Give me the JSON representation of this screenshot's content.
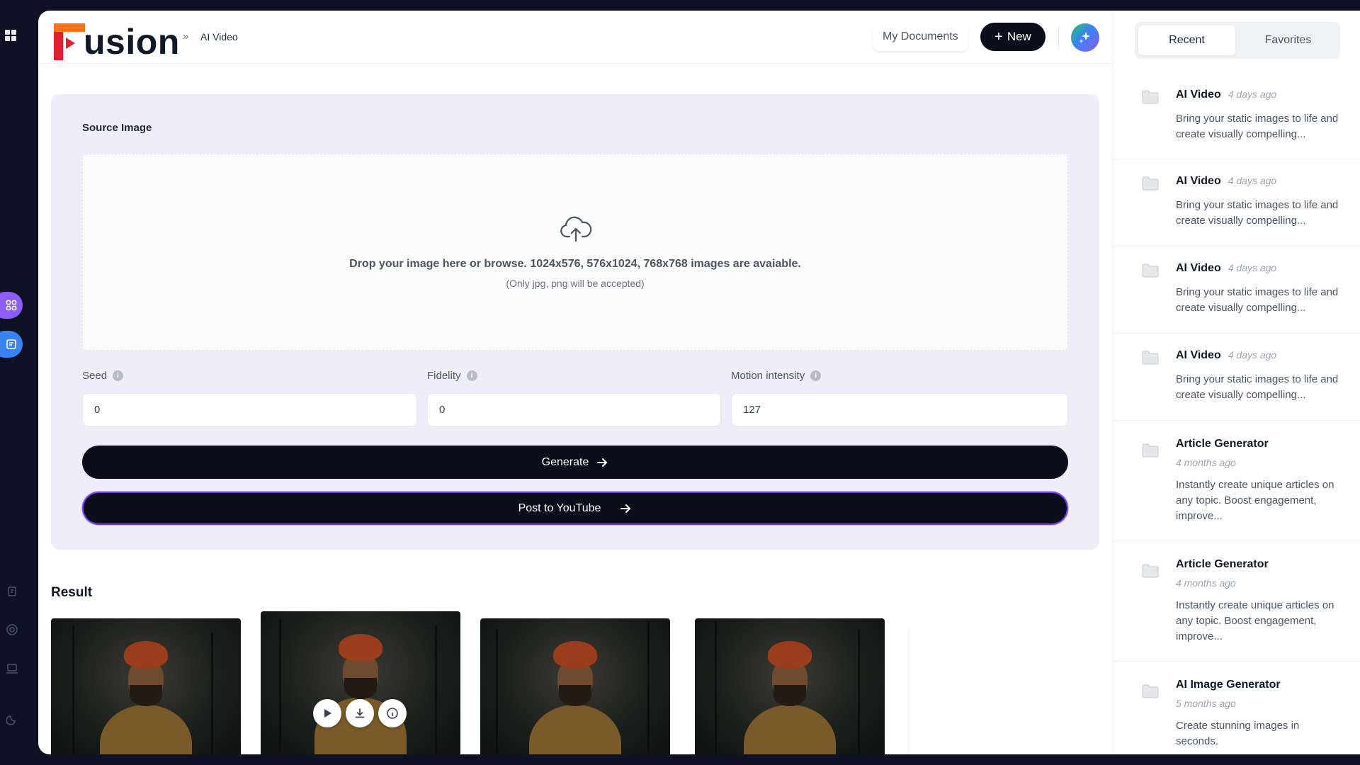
{
  "app": {
    "brand_initial": "F",
    "brand_rest": "usion",
    "breadcrumb": "AI Video"
  },
  "header": {
    "my_documents": "My Documents",
    "new_label": "New"
  },
  "form": {
    "section_title": "Source Image",
    "drop_main": "Drop your image here or browse. 1024x576, 576x1024, 768x768 images are avaiable.",
    "drop_sub": "(Only jpg, png will be accepted)",
    "seed_label": "Seed",
    "seed_value": "0",
    "fidelity_label": "Fidelity",
    "fidelity_value": "0",
    "motion_label": "Motion intensity",
    "motion_value": "127",
    "generate_label": "Generate",
    "youtube_label": "Post to YouTube"
  },
  "result": {
    "title": "Result"
  },
  "sidebar": {
    "tabs": [
      "Recent",
      "Favorites"
    ],
    "items": [
      {
        "title": "AI Video",
        "time": "4 days ago",
        "desc": "Bring your static images to life and create visually compelling..."
      },
      {
        "title": "AI Video",
        "time": "4 days ago",
        "desc": "Bring your static images to life and create visually compelling..."
      },
      {
        "title": "AI Video",
        "time": "4 days ago",
        "desc": "Bring your static images to life and create visually compelling..."
      },
      {
        "title": "AI Video",
        "time": "4 days ago",
        "desc": "Bring your static images to life and create visually compelling..."
      },
      {
        "title": "Article Generator",
        "time": "4 months ago",
        "desc": "Instantly create unique articles on any topic. Boost engagement, improve..."
      },
      {
        "title": "Article Generator",
        "time": "4 months ago",
        "desc": "Instantly create unique articles on any topic. Boost engagement, improve..."
      },
      {
        "title": "AI Image Generator",
        "time": "5 months ago",
        "desc": "Create stunning images in seconds."
      }
    ]
  },
  "colors": {
    "accent": "#7c3aed",
    "dark_button": "#0b0f1c",
    "panel_bg": "#efedf9",
    "logo_red": "#e11d2e",
    "logo_orange": "#f59e0b"
  },
  "icons": [
    "apps-grid-icon",
    "cloud-upload-icon",
    "info-icon",
    "arrow-right-icon",
    "plus-icon",
    "sparkle-icon",
    "folder-icon",
    "play-icon",
    "download-icon",
    "info-circle-icon"
  ]
}
